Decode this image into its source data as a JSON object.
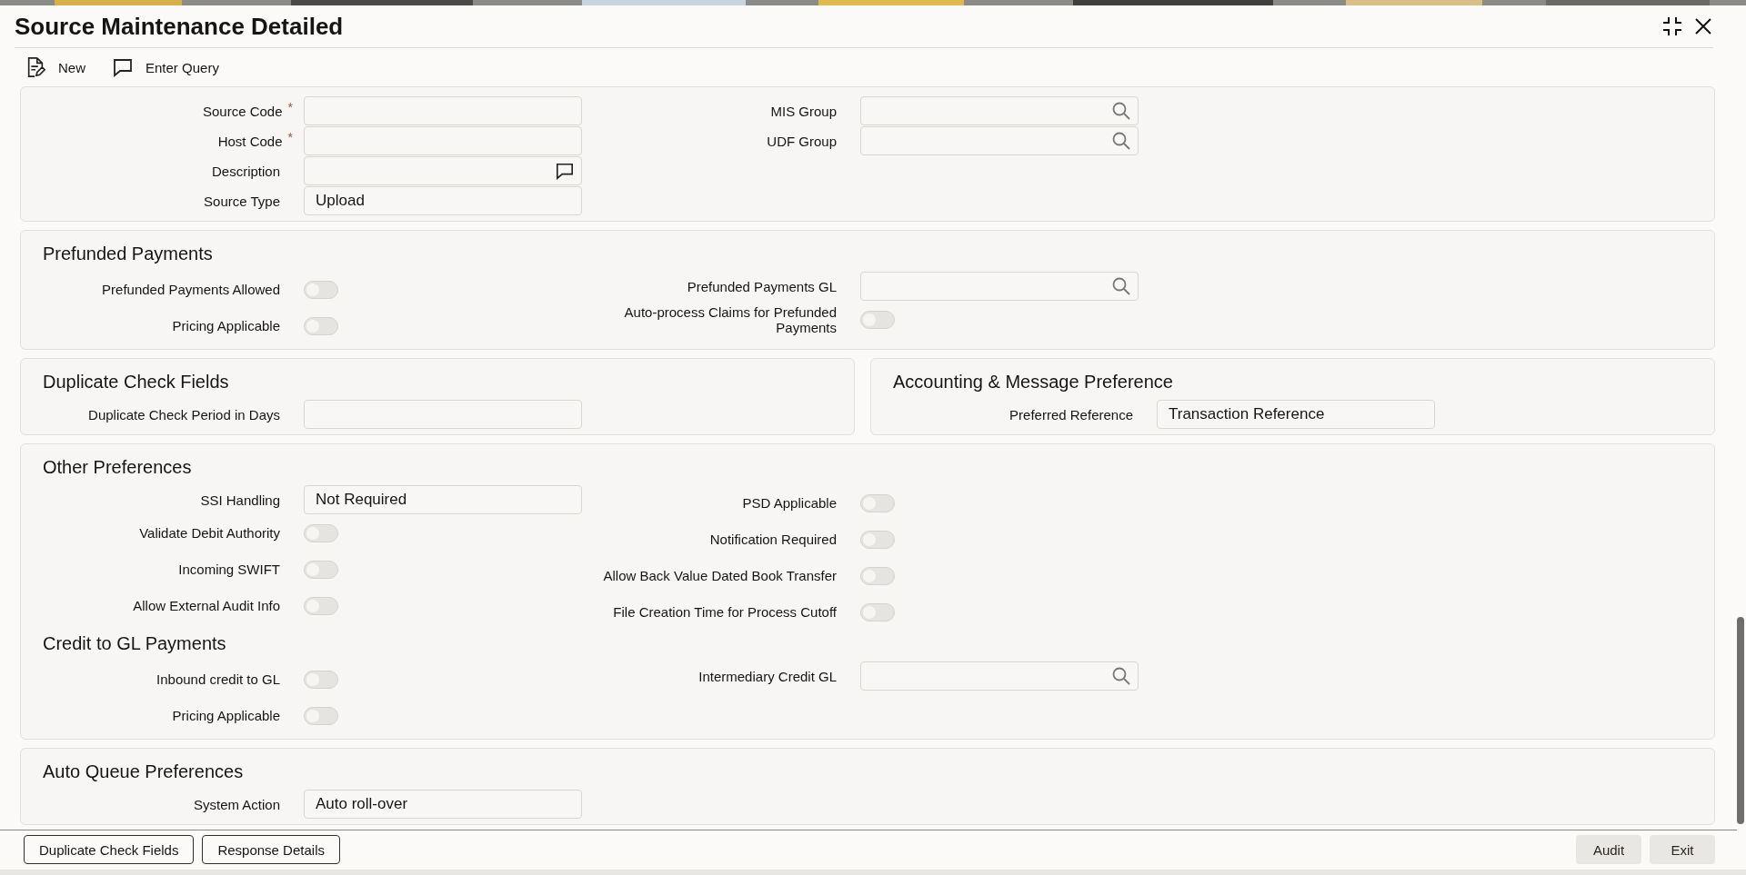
{
  "title": "Source Maintenance Detailed",
  "toolbar": [
    {
      "label": "New",
      "kind": "new"
    },
    {
      "label": "Enter Query",
      "kind": "query"
    }
  ],
  "rows": [
    {
      "panels": [
        {
          "groups": [
            {
              "left": [
                {
                  "label": "Source Code",
                  "kind": "text",
                  "required_mark": "*"
                },
                {
                  "label": "Host Code",
                  "kind": "text",
                  "required_mark": "*"
                },
                {
                  "label": "Description",
                  "kind": "comment"
                },
                {
                  "label": "Source Type",
                  "kind": "text",
                  "value": "Upload"
                }
              ],
              "right": [
                {
                  "label": "MIS Group",
                  "kind": "lookup"
                },
                {
                  "label": "UDF Group",
                  "kind": "lookup"
                }
              ]
            }
          ]
        }
      ]
    },
    {
      "panels": [
        {
          "groups": [
            {
              "heading": "Prefunded Payments",
              "left": [
                {
                  "label": "Prefunded Payments Allowed",
                  "kind": "toggle",
                  "on": false
                },
                {
                  "label": "Pricing Applicable",
                  "kind": "toggle",
                  "on": false
                }
              ],
              "right": [
                {
                  "label": "Prefunded Payments GL",
                  "kind": "lookup"
                },
                {
                  "label": "Auto-process Claims for Prefunded Payments",
                  "kind": "toggle",
                  "on": false
                }
              ]
            }
          ]
        }
      ]
    },
    {
      "panels": [
        {
          "groups": [
            {
              "heading": "Duplicate Check Fields",
              "left": [
                {
                  "label": "Duplicate Check Period in Days",
                  "kind": "text"
                }
              ]
            }
          ]
        },
        {
          "groups": [
            {
              "heading": "Accounting & Message Preference",
              "left": [
                {
                  "label": "Preferred Reference",
                  "kind": "text",
                  "value": "Transaction Reference"
                }
              ]
            }
          ]
        }
      ]
    },
    {
      "panels": [
        {
          "groups": [
            {
              "heading": "Other Preferences",
              "left": [
                {
                  "label": "SSI Handling",
                  "kind": "text",
                  "value": "Not Required"
                },
                {
                  "label": "Validate Debit Authority",
                  "kind": "toggle",
                  "on": false
                },
                {
                  "label": "Incoming SWIFT",
                  "kind": "toggle",
                  "on": false
                },
                {
                  "label": "Allow External Audit Info",
                  "kind": "toggle",
                  "on": false
                }
              ],
              "right": [
                {
                  "label": "PSD Applicable",
                  "kind": "toggle",
                  "on": false
                },
                {
                  "label": "Notification Required",
                  "kind": "toggle",
                  "on": false
                },
                {
                  "label": "Allow Back Value Dated Book Transfer",
                  "kind": "toggle",
                  "on": false
                },
                {
                  "label": "File Creation Time for Process Cutoff",
                  "kind": "toggle",
                  "on": false
                }
              ]
            },
            {
              "heading": "Credit to GL Payments",
              "left": [
                {
                  "label": "Inbound credit to GL",
                  "kind": "toggle",
                  "on": false
                },
                {
                  "label": "Pricing Applicable",
                  "kind": "toggle",
                  "on": false
                }
              ],
              "right": [
                {
                  "label": "Intermediary Credit GL",
                  "kind": "lookup"
                }
              ]
            }
          ]
        }
      ]
    },
    {
      "panels": [
        {
          "groups": [
            {
              "heading": "Auto Queue Preferences",
              "left": [
                {
                  "label": "System Action",
                  "kind": "text",
                  "value": "Auto roll-over"
                }
              ]
            }
          ]
        }
      ]
    }
  ],
  "footer_left": [
    {
      "label": "Duplicate Check Fields",
      "disabled": false
    },
    {
      "label": "Response Details",
      "disabled": false
    }
  ],
  "footer_right": [
    {
      "label": "Audit",
      "disabled": true
    },
    {
      "label": "Exit",
      "disabled": true
    }
  ]
}
